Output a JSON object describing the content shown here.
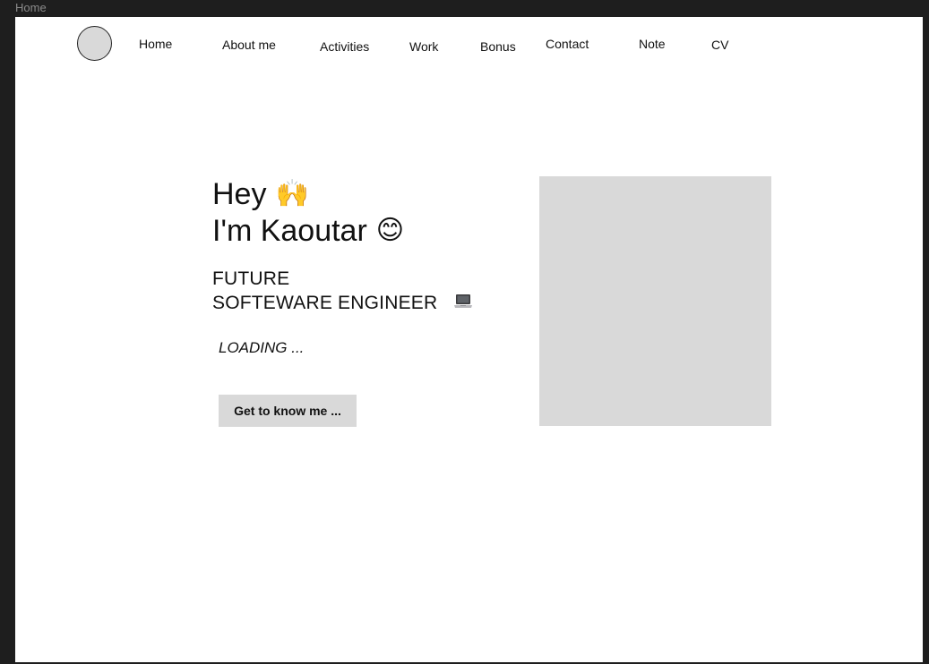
{
  "frame": {
    "label": "Home"
  },
  "nav": {
    "items": [
      {
        "label": "Home"
      },
      {
        "label": "About me"
      },
      {
        "label": "Activities"
      },
      {
        "label": "Work"
      },
      {
        "label": "Bonus"
      },
      {
        "label": "Contact"
      },
      {
        "label": "Note"
      },
      {
        "label": "CV"
      }
    ]
  },
  "hero": {
    "greeting": "Hey",
    "greeting_emoji": "🙌",
    "name_line": "I'm Kaoutar",
    "name_emoji": "😊",
    "subtitle_line1": "FUTURE",
    "subtitle_line2": "SOFTEWARE ENGINEER",
    "subtitle_icon": "laptop-icon",
    "status": "LOADING ...",
    "cta_label": "Get to know me ..."
  },
  "colors": {
    "background": "#1e1e1e",
    "frame": "#ffffff",
    "placeholder": "#d9d9d9",
    "text": "#111111"
  }
}
